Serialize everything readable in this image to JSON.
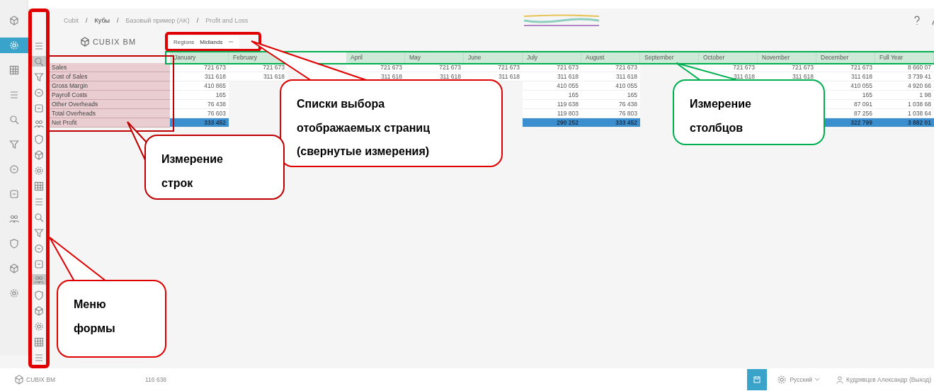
{
  "breadcrumb": [
    "Cubit",
    "Кубы",
    "Базовый пример (AK)",
    "Profit and Loss"
  ],
  "breadcrumb_separator": "/",
  "left_nav": [
    {
      "selected": false
    },
    {
      "selected": true
    },
    {
      "selected": false
    },
    {
      "selected": false
    },
    {
      "selected": false
    },
    {
      "selected": false
    },
    {
      "selected": false
    },
    {
      "selected": false
    },
    {
      "selected": false
    },
    {
      "selected": false
    },
    {
      "selected": false
    },
    {
      "selected": false
    }
  ],
  "form_menu": [
    {
      "selected": false
    },
    {
      "selected": true
    },
    {
      "selected": false
    },
    {
      "selected": false
    },
    {
      "selected": false
    },
    {
      "selected": false
    },
    {
      "selected": false
    },
    {
      "selected": false
    },
    {
      "selected": false
    },
    {
      "selected": false
    },
    {
      "selected": false
    },
    {
      "selected": false
    },
    {
      "selected": false
    },
    {
      "selected": false
    },
    {
      "selected": false
    },
    {
      "selected": true
    },
    {
      "selected": false
    },
    {
      "selected": false
    },
    {
      "selected": false
    },
    {
      "selected": false
    },
    {
      "selected": false
    }
  ],
  "logo": "CUBIX BM",
  "page_selector": {
    "label": "Regions",
    "value": "Midlands"
  },
  "table": {
    "columns": [
      "January",
      "February",
      "April",
      "May",
      "June",
      "July",
      "August",
      "September",
      "October",
      "November",
      "December",
      "Full Year"
    ],
    "rows": [
      {
        "label": "Sales",
        "kind": "normal",
        "values": [
          "721 673",
          "721 673",
          "721 673",
          "721 673",
          "721 673",
          "721 673",
          "721 673",
          "721 673",
          "721 673",
          "721 673",
          "8 660 07"
        ]
      },
      {
        "label": "Cost of Sales",
        "kind": "normal",
        "values": [
          "311 618",
          "311 618",
          "311 618",
          "311 618",
          "311 618",
          "311 618",
          "311 618",
          "311 618",
          "311 618",
          "311 618",
          "3 739 41"
        ]
      },
      {
        "label": "Gross Margin",
        "kind": "normal",
        "values": [
          "410 865",
          "410 055",
          "410 055",
          "410 055",
          "4 920 66"
        ]
      },
      {
        "label": "Payroll Costs",
        "kind": "normal",
        "values": [
          "165",
          "165",
          "165",
          "165",
          "1 98"
        ]
      },
      {
        "label": "Other Overheads",
        "kind": "normal",
        "values": [
          "76 438",
          "119 638",
          "76 438",
          "87 091",
          "1 038 68"
        ]
      },
      {
        "label": "Total Overheads",
        "kind": "normal",
        "values": [
          "76 603",
          "119 803",
          "76 803",
          "87 256",
          "1 038 64"
        ]
      },
      {
        "label": "Net Profit",
        "kind": "total",
        "values": [
          "333 452",
          "290 252",
          "333 452",
          "322 799",
          "3 882 01"
        ]
      }
    ]
  },
  "status_bar": {
    "logo": "CUBIX BM",
    "count": "116 638",
    "language": "Русский",
    "user": "Кудрявцев Александр (Выход)"
  },
  "annotations": [
    {
      "text": "Списки выбора отображаемых страниц (свернутые измерения)",
      "color": "#e00000"
    },
    {
      "text": "Измерение столбцов",
      "color": "#00b050"
    },
    {
      "text": "Измерение строк",
      "color": "#c00000"
    },
    {
      "text": "Меню формы",
      "color": "#e00000"
    }
  ]
}
